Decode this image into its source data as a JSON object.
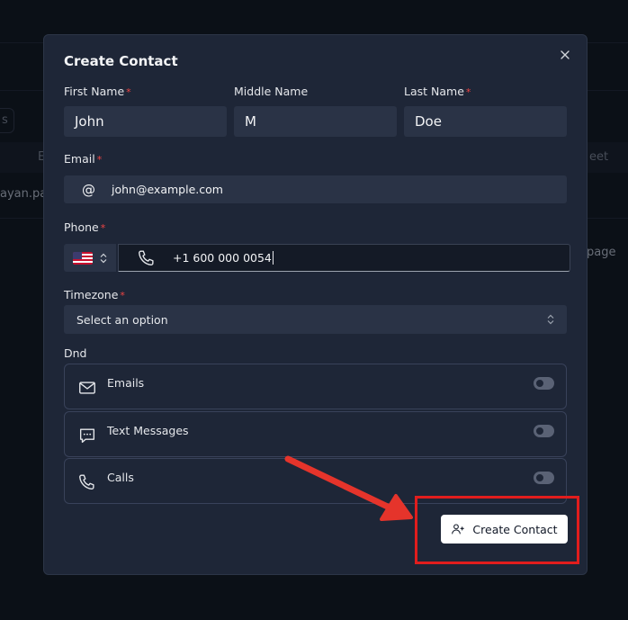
{
  "background": {
    "email_col": "E",
    "row_text": "ayan.pa",
    "right_col": "eet",
    "right_text": "page",
    "pill_text": "s"
  },
  "modal": {
    "title": "Create Contact",
    "first_name": {
      "label": "First Name",
      "value": "John"
    },
    "middle_name": {
      "label": "Middle Name",
      "value": "M"
    },
    "last_name": {
      "label": "Last Name",
      "value": "Doe"
    },
    "email": {
      "label": "Email",
      "value": "john@example.com"
    },
    "phone": {
      "label": "Phone",
      "country": "US",
      "value": "+1 600 000 0054"
    },
    "timezone": {
      "label": "Timezone",
      "placeholder": "Select an option"
    },
    "dnd": {
      "label": "Dnd",
      "items": [
        {
          "label": "Emails",
          "icon": "mail-icon",
          "enabled": false
        },
        {
          "label": "Text Messages",
          "icon": "message-icon",
          "enabled": false
        },
        {
          "label": "Calls",
          "icon": "phone-icon",
          "enabled": false
        }
      ]
    },
    "submit_label": "Create Contact",
    "required_marker": "*"
  },
  "colors": {
    "accent_red": "#e11d1d",
    "modal_bg": "#1e2637",
    "field_bg": "#2a3346"
  }
}
